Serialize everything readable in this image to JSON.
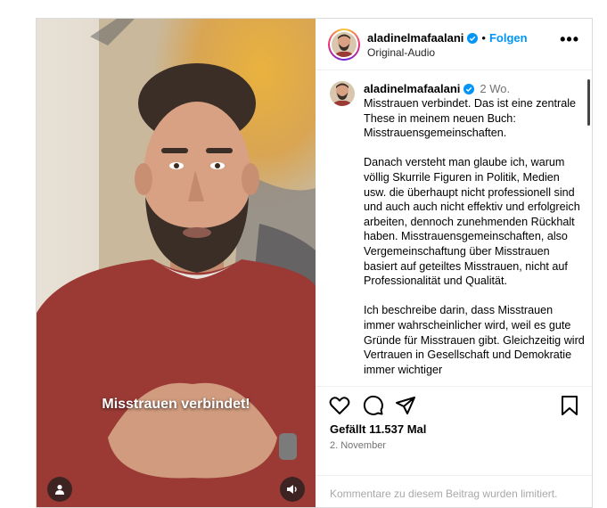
{
  "post": {
    "username": "aladinelmafaalani",
    "follow_label": "Folgen",
    "separator": "•",
    "audio_label": "Original-Audio",
    "more_label": "•••",
    "video_overlay_text": "Misstrauen verbindet!"
  },
  "caption": {
    "username": "aladinelmafaalani",
    "time": "2 Wo.",
    "text": "Misstrauen verbindet. Das ist eine zentrale These in meinem neuen Buch: Misstrauensgemeinschaften.\n\nDanach versteht man glaube ich, warum völlig Skurrile Figuren in Politik, Medien usw. die überhaupt nicht professionell sind und auch auch nicht effektiv und erfolgreich arbeiten, dennoch zunehmenden Rückhalt haben. Misstrauensgemeinschaften, also Vergemeinschaftung über Misstrauen basiert auf geteiltes Misstrauen, nicht auf Professionalität und Qualität.\n\nIch beschreibe darin, dass Misstrauen immer wahrscheinlicher wird, weil es gute Gründe für Misstrauen gibt. Gleichzeitig wird Vertrauen in Gesellschaft und Demokratie immer wichtiger"
  },
  "footer": {
    "likes": "Gefällt 11.537 Mal",
    "date": "2. November",
    "comments_limited": "Kommentare zu diesem Beitrag wurden limitiert."
  },
  "icons": {
    "like": "heart-icon",
    "comment": "comment-icon",
    "share": "share-icon",
    "save": "bookmark-icon",
    "verified": "verified-badge-icon",
    "tagged_user": "user-tag-icon",
    "audio": "speaker-icon"
  },
  "colors": {
    "verified": "#0095f6",
    "follow": "#0095f6",
    "sweater": "#9b3a35"
  }
}
